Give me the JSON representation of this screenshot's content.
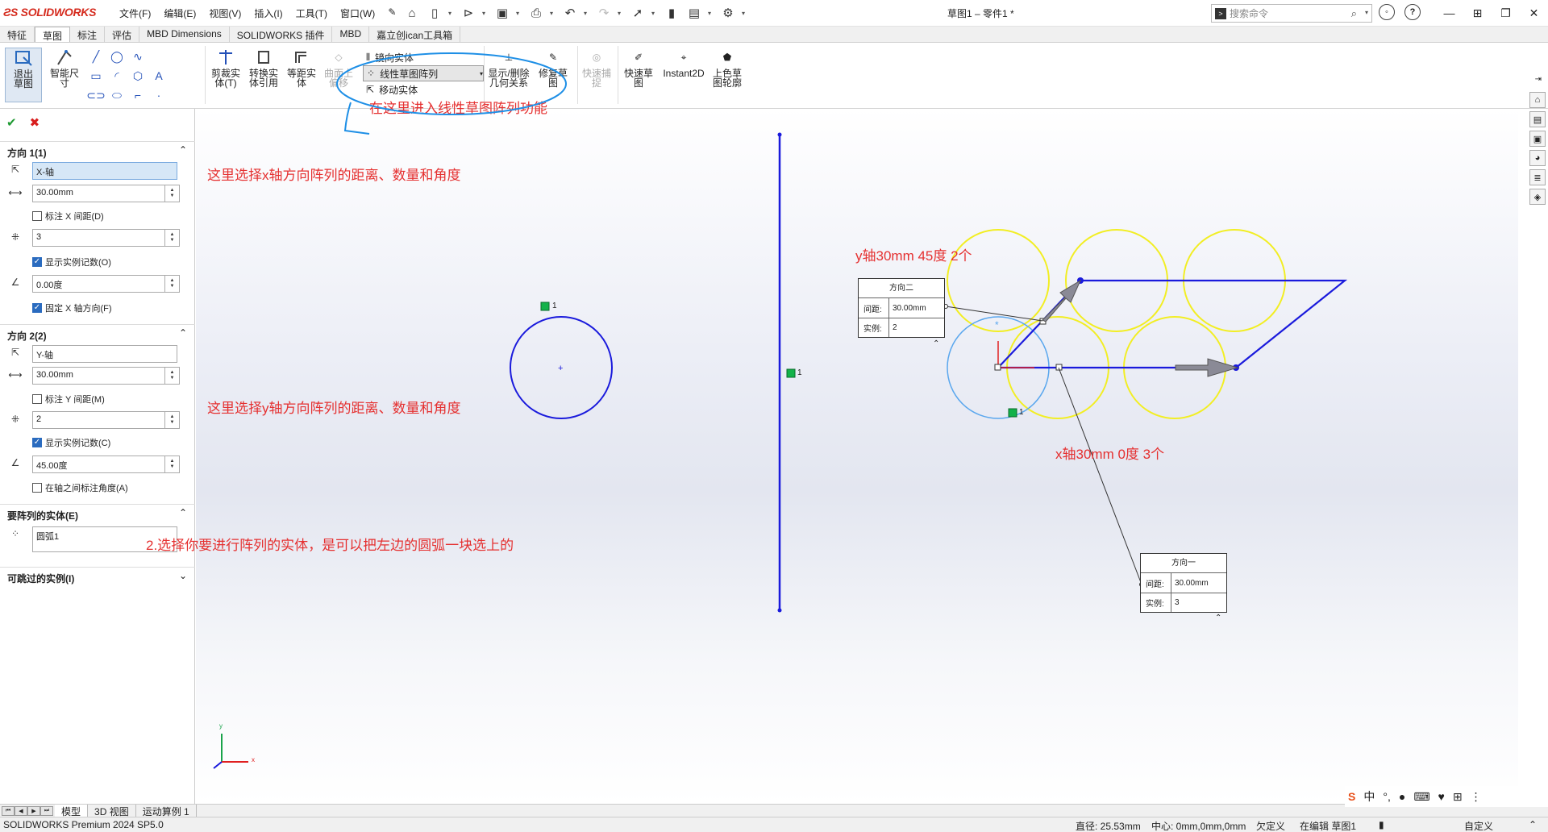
{
  "app": {
    "logo": "SOLIDWORKS",
    "document_title": "草图1 – 零件1 *"
  },
  "menu": [
    "文件(F)",
    "编辑(E)",
    "视图(V)",
    "插入(I)",
    "工具(T)",
    "窗口(W)"
  ],
  "search": {
    "placeholder": "搜索命令"
  },
  "ribbon_tabs": [
    "特征",
    "草图",
    "标注",
    "评估",
    "MBD Dimensions",
    "SOLIDWORKS 插件",
    "MBD",
    "嘉立创ican工具箱"
  ],
  "active_ribbon_tab": "草图",
  "ribbon": {
    "exit_sketch": "退出草图",
    "smart_dim": "智能尺寸",
    "trim": "剪裁实体(T)",
    "convert": "转换实体引用",
    "offset": "等距实体",
    "surface_offset": "曲面上偏移",
    "mirror": "镜向实体",
    "linear_pattern": "线性草图阵列",
    "move": "移动实体",
    "relations": "显示/删除几何关系",
    "repair": "修复草图",
    "quick_snap": "快速捕捉",
    "rapid_sketch": "快速草图",
    "instant2d": "Instant2D",
    "shaded_contours": "上色草图轮廓"
  },
  "panel": {
    "dir1": {
      "header": "方向 1(1)",
      "axis": "X-轴",
      "spacing": "30.00mm",
      "dim_spacing": "标注 X 间距(D)",
      "count": "3",
      "show_count": "显示实例记数(O)",
      "angle": "0.00度",
      "fix_dir": "固定 X 轴方向(F)"
    },
    "dir2": {
      "header": "方向 2(2)",
      "axis": "Y-轴",
      "spacing": "30.00mm",
      "dim_spacing": "标注 Y 间距(M)",
      "count": "2",
      "show_count": "显示实例记数(C)",
      "angle": "45.00度",
      "dim_angle": "在轴之间标注角度(A)"
    },
    "entities": {
      "header": "要阵列的实体(E)",
      "value": "圆弧1"
    },
    "skip": {
      "header": "可跳过的实例(I)"
    }
  },
  "annotations": {
    "a1": "在这里进入线性草图阵列功能",
    "a2": "这里选择x轴方向阵列的距离、数量和角度",
    "a3": "这里选择y轴方向阵列的距离、数量和角度",
    "a4": "2.选择你要进行阵列的实体，是可以把左边的圆弧一块选上的",
    "a5": "y轴30mm 45度 2个",
    "a6": "x轴30mm 0度 3个"
  },
  "dimbox_dir2": {
    "title": "方向二",
    "spacing_label": "间距:",
    "spacing": "30.00mm",
    "count_label": "实例:",
    "count": "2"
  },
  "dimbox_dir1": {
    "title": "方向一",
    "spacing_label": "间距:",
    "spacing": "30.00mm",
    "count_label": "实例:",
    "count": "3"
  },
  "sketch_labels": {
    "mark1": "1",
    "mark2": "1",
    "mark3": "1"
  },
  "triad": {
    "x": "x",
    "y": "y"
  },
  "bottom_tabs": [
    "模型",
    "3D 视图",
    "运动算例 1"
  ],
  "status": {
    "product": "SOLIDWORKS Premium 2024 SP5.0",
    "diameter": "直径: 25.53mm",
    "center": "中心: 0mm,0mm,0mm",
    "defined": "欠定义",
    "editing": "在编辑 草图1",
    "custom": "自定义"
  },
  "ime": {
    "lang": "中"
  },
  "colors": {
    "pattern_line": "#1a1adc",
    "instance_circle": "#f2ee23",
    "selected_circle": "#5aa7ee",
    "annotation": "#e53030"
  }
}
